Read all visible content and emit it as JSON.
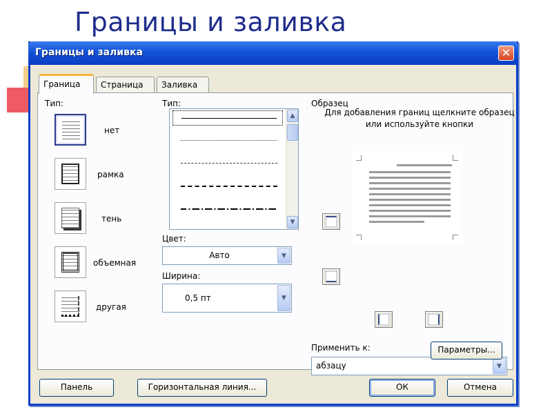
{
  "slide_title": "Границы и заливка",
  "dialog": {
    "title": "Границы и заливка",
    "close_glyph": "✕",
    "tabs": [
      {
        "label": "Граница",
        "active": true
      },
      {
        "label": "Страница",
        "active": false
      },
      {
        "label": "Заливка",
        "active": false
      }
    ],
    "type_section": {
      "label": "Тип:",
      "presets": [
        {
          "label": "нет",
          "icon": "border-none-icon",
          "selected": true
        },
        {
          "label": "рамка",
          "icon": "border-box-icon",
          "selected": false
        },
        {
          "label": "тень",
          "icon": "border-shadow-icon",
          "selected": false
        },
        {
          "label": "объемная",
          "icon": "border-3d-icon",
          "selected": false
        },
        {
          "label": "другая",
          "icon": "border-custom-icon",
          "selected": false
        }
      ]
    },
    "style_section": {
      "label": "Тип:",
      "line_styles": [
        "solid",
        "dotted",
        "dashed-fine",
        "dashed",
        "dash-dot"
      ],
      "color_label": "Цвет:",
      "color_value": "Авто",
      "width_label": "Ширина:",
      "width_value": "0,5 пт"
    },
    "preview_section": {
      "label": "Образец",
      "note": "Для добавления границ щелкните образец или используйте кнопки",
      "apply_label": "Применить к:",
      "apply_value": "абзацу",
      "options_button": "Параметры..."
    },
    "footer": {
      "panel_button": "Панель",
      "hline_button": "Горизонтальная линия...",
      "ok_button": "ОК",
      "cancel_button": "Отмена"
    }
  }
}
